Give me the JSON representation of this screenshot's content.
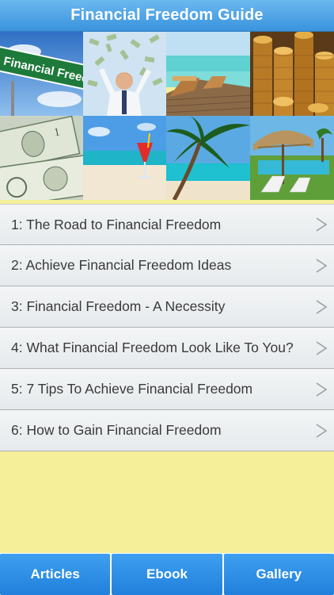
{
  "header": {
    "title": "Financial Freedom Guide"
  },
  "gallery": {
    "sign_text": "Financial Freedo",
    "images": [
      {
        "subject": "financial-freedom-road-sign"
      },
      {
        "subject": "man-with-flying-money"
      },
      {
        "subject": "tropical-beach-deck-chairs"
      },
      {
        "subject": "stacks-of-gold-coins"
      },
      {
        "subject": "dollar-bills"
      },
      {
        "subject": "beach-with-cocktail"
      },
      {
        "subject": "palm-tree-beach"
      },
      {
        "subject": "poolside-thatched-umbrella"
      }
    ]
  },
  "articles": [
    {
      "label": "1: The Road to Financial Freedom"
    },
    {
      "label": "2: Achieve Financial Freedom Ideas"
    },
    {
      "label": "3: Financial Freedom - A Necessity"
    },
    {
      "label": "4: What Financial Freedom Look Like To You?"
    },
    {
      "label": "5: 7 Tips To Achieve Financial Freedom"
    },
    {
      "label": "6: How to Gain Financial Freedom"
    }
  ],
  "tabs": {
    "articles": "Articles",
    "ebook": "Ebook",
    "gallery": "Gallery"
  },
  "colors": {
    "header_blue": "#3a93dc",
    "tab_blue": "#2180db",
    "background_yellow": "#f5ef9a"
  }
}
